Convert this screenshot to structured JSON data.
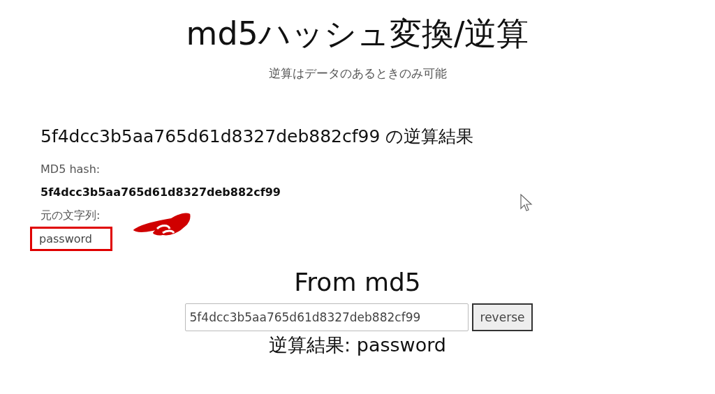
{
  "header": {
    "title": "md5ハッシュ変換/逆算",
    "subtitle": "逆算はデータのあるときのみ可能"
  },
  "result": {
    "heading": "5f4dcc3b5aa765d61d8327deb882cf99 の逆算結果",
    "fields": [
      {
        "label": "MD5 hash:",
        "value": "5f4dcc3b5aa765d61d8327deb882cf99",
        "highlighted": false
      },
      {
        "label": "元の文字列:",
        "value": "password",
        "highlighted": true
      }
    ]
  },
  "from_md5": {
    "title": "From md5",
    "input": {
      "value": "5f4dcc3b5aa765d61d8327deb882cf99"
    },
    "button": "reverse",
    "output": "逆算結果: password"
  }
}
